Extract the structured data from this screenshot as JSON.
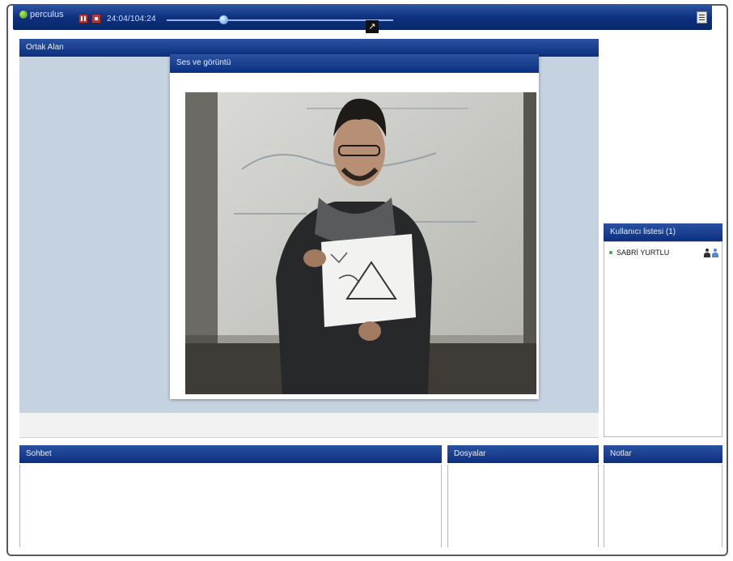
{
  "toolbar": {
    "logo_text": "perculus",
    "timecode": "24:04/104:24",
    "seek_progress_pct": 25
  },
  "panels": {
    "ortak_alan": {
      "title": "Ortak Alan"
    },
    "ses_goruntu": {
      "title": "Ses ve görüntü"
    },
    "kullanici_listesi": {
      "title": "Kullanıcı listesi (1)",
      "users": [
        {
          "name": "SABRİ YURTLU"
        }
      ]
    },
    "sohbet": {
      "title": "Sohbet"
    },
    "dosyalar": {
      "title": "Dosyalar"
    },
    "notlar": {
      "title": "Notlar"
    }
  }
}
